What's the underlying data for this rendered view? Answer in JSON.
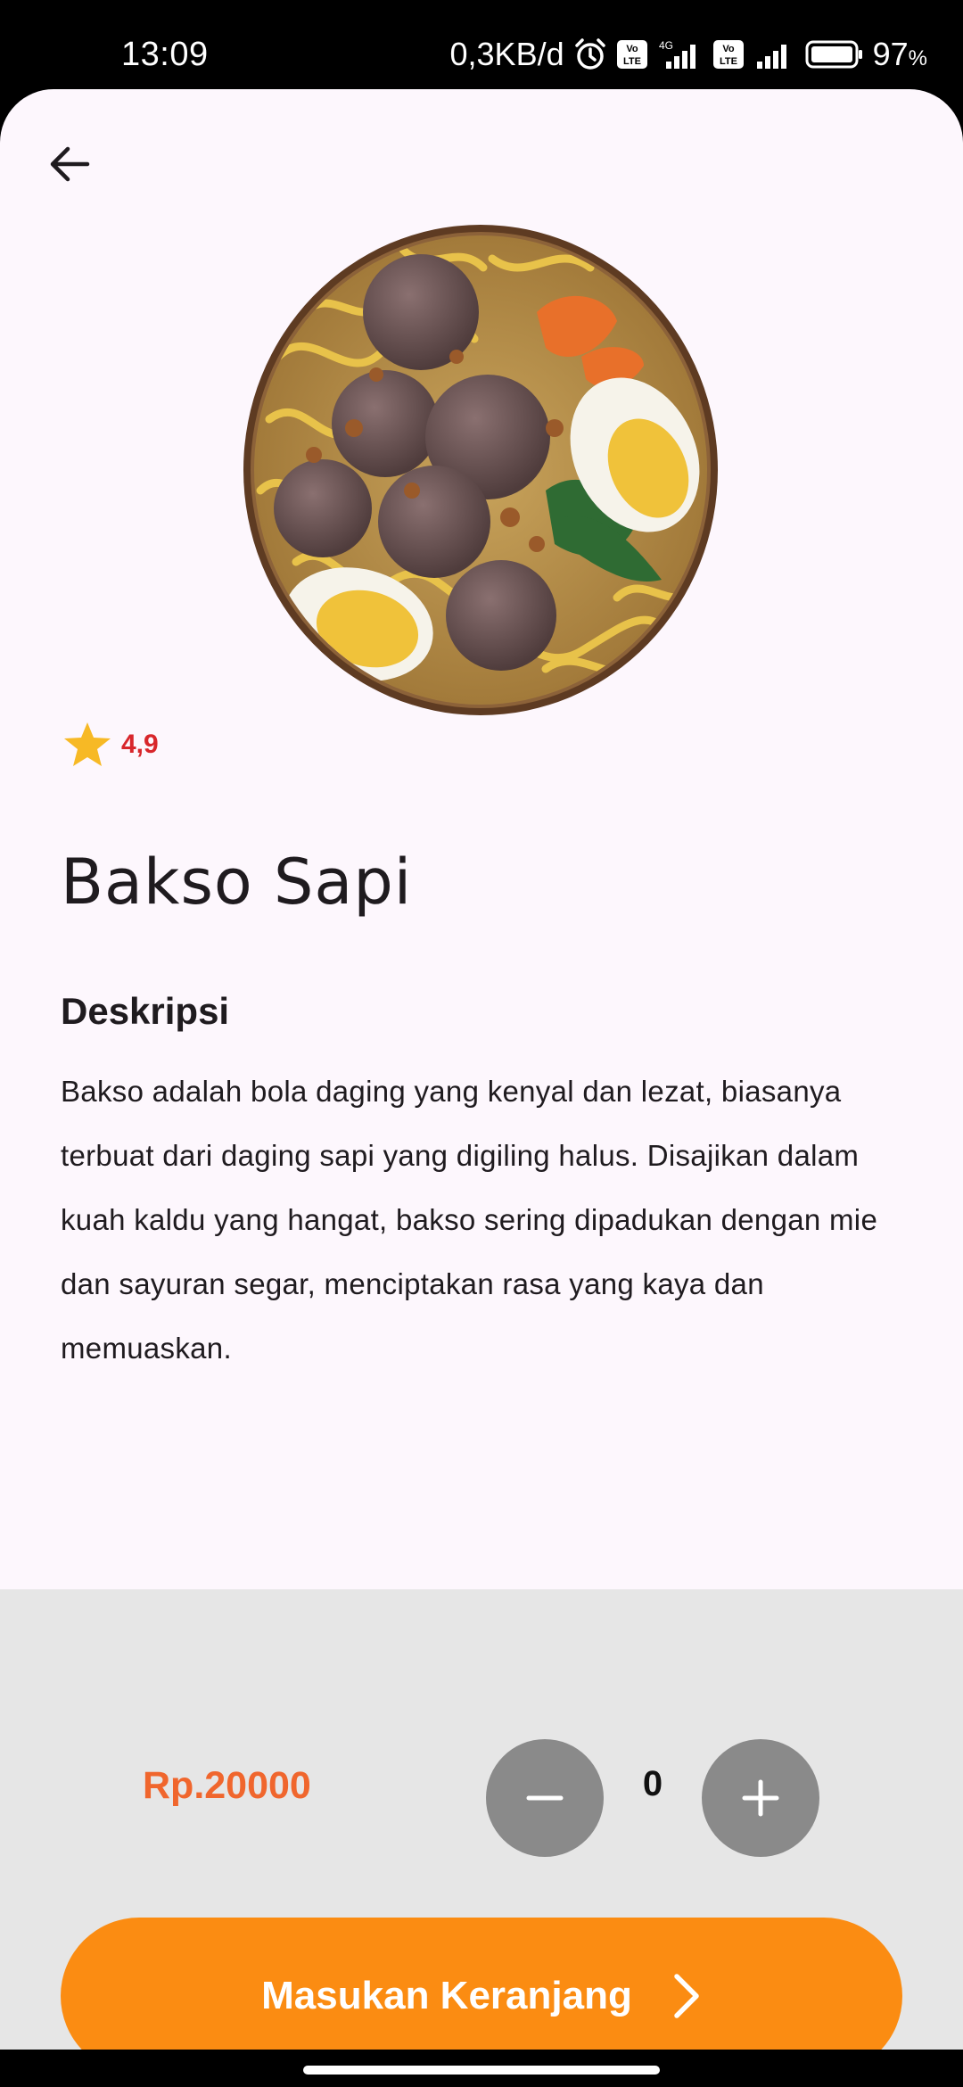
{
  "status_bar": {
    "time": "13:09",
    "network_speed": "0,3KB/d",
    "battery_percent": "97",
    "battery_unit": "%",
    "icons": [
      "alarm-icon",
      "volte-icon",
      "signal-4g-icon",
      "volte-icon",
      "signal-icon",
      "battery-icon"
    ]
  },
  "header": {
    "back_icon": "arrow-left-icon"
  },
  "product": {
    "image": "bakso-bowl-image",
    "rating_icon": "star-icon",
    "rating": "4,9",
    "name": "Bakso Sapi",
    "description_heading": "Deskripsi",
    "description": "Bakso adalah bola daging yang kenyal dan lezat, biasanya terbuat dari daging sapi yang digiling halus. Disajikan dalam kuah kaldu yang hangat, bakso sering dipadukan dengan mie dan sayuran segar, menciptakan rasa yang kaya dan memuaskan."
  },
  "order": {
    "price": "Rp.20000",
    "quantity": "0",
    "minus_icon": "minus-icon",
    "plus_icon": "plus-icon",
    "cart_label": "Masukan Keranjang",
    "cart_icon": "chevron-right-icon"
  },
  "colors": {
    "accent": "#fb8c12",
    "price": "#f0662d",
    "rating": "#d8262b",
    "star": "#f7b925",
    "background": "#fdf7fd",
    "panel": "#e6e6e6",
    "qty_button": "#8a8a8a"
  }
}
